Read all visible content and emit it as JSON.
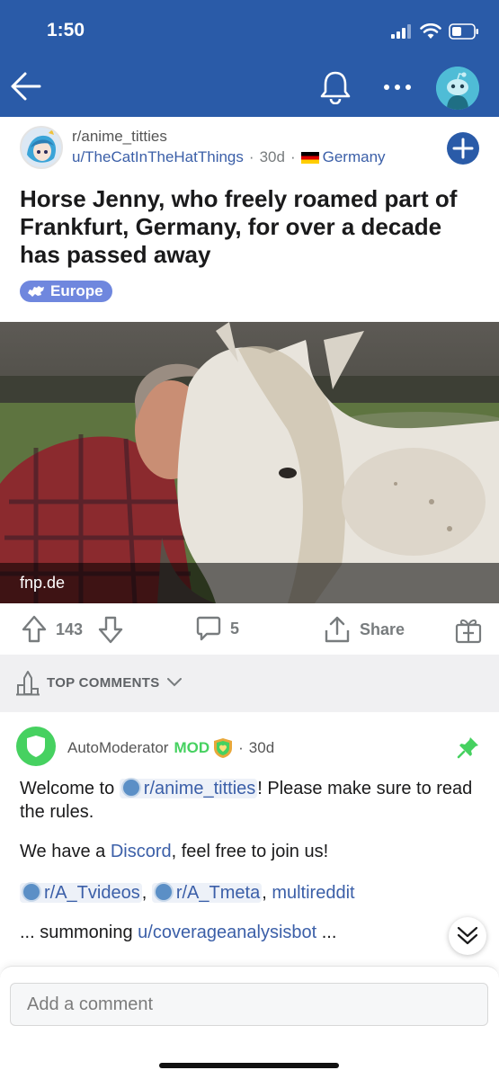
{
  "status_bar": {
    "time": "1:50"
  },
  "colors": {
    "header_bg": "#2a5ba8",
    "link": "#3b5fa8",
    "mod_green": "#46d160",
    "flair_bg": "#6f87de"
  },
  "header": {
    "back_icon": "arrow-left-icon",
    "bell_icon": "bell-icon",
    "more_icon": "more-horizontal-icon",
    "avatar_icon": "snoo-avatar-icon"
  },
  "post": {
    "subreddit": "r/anime_titties",
    "author": "u/TheCatInTheHatThings",
    "age": "30d",
    "country": "Germany",
    "title": "Horse Jenny, who freely roamed part of Frankfurt, Germany, for over a decade has passed away",
    "flair": "Europe",
    "image_caption": "fnp.de",
    "score": "143",
    "comment_count": "5",
    "share_label": "Share"
  },
  "comments_header": {
    "label": "TOP COMMENTS"
  },
  "comment": {
    "author": "AutoModerator",
    "mod_label": "MOD",
    "age": "30d",
    "p1_pre": "Welcome to ",
    "p1_sub": "r/anime_titties",
    "p1_post": "! Please make sure to read the rules.",
    "p2_pre": "We have a ",
    "p2_link": "Discord",
    "p2_post": ", feel free to join us!",
    "p3_sub1": "r/A_Tvideos",
    "p3_sep": ", ",
    "p3_sub2": "r/A_Tmeta",
    "p3_sep2": ", ",
    "p3_link": "multireddit",
    "p4_pre": "... summoning ",
    "p4_user": "u/coverageanalysisbot",
    "p4_post": " ..."
  },
  "composer": {
    "placeholder": "Add a comment"
  }
}
